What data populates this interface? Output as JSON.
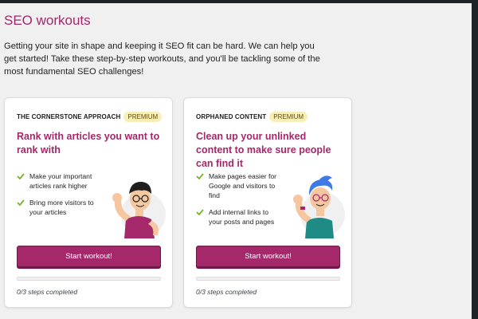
{
  "page": {
    "title": "SEO workouts",
    "intro": "Getting your site in shape and keeping it SEO fit can be hard. We can help you get started! Take these step-by-step workouts, and you'll be tackling some of the most fundamental SEO challenges!"
  },
  "colors": {
    "accent": "#a4286a",
    "badge_bg": "#f8efb8",
    "check": "#77b227"
  },
  "workouts": [
    {
      "label": "THE CORNERSTONE APPROACH",
      "badge": "PREMIUM",
      "title": "Rank with articles you want to rank with",
      "benefits": [
        "Make your important articles rank higher",
        "Bring more visitors to your articles"
      ],
      "illustration": "man-flexing-icon",
      "button_label": "Start workout!",
      "progress": 0,
      "progress_text": "0/3 steps completed"
    },
    {
      "label": "ORPHANED CONTENT",
      "badge": "PREMIUM",
      "title": "Clean up your unlinked content to make sure people can find it",
      "benefits": [
        "Make pages easier for Google and visitors to find",
        "Add internal links to your posts and pages"
      ],
      "illustration": "woman-flexing-icon",
      "button_label": "Start workout!",
      "progress": 0,
      "progress_text": "0/3 steps completed"
    }
  ]
}
